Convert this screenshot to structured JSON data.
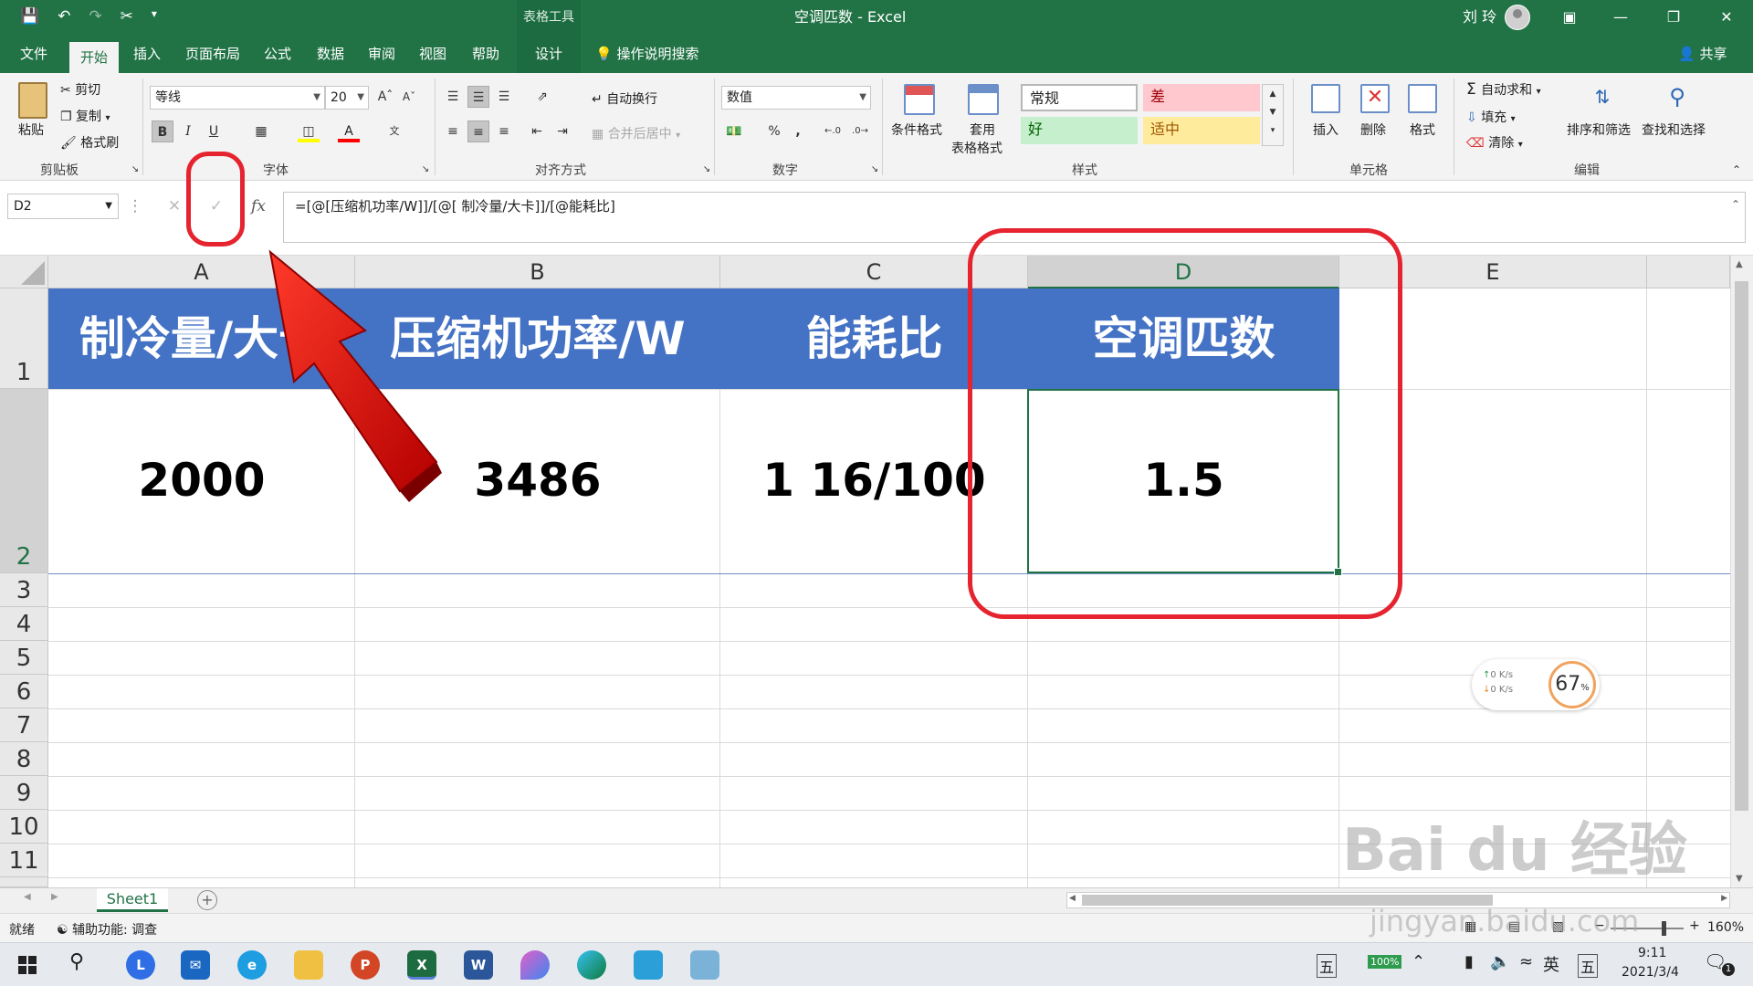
{
  "titlebar": {
    "context_label": "表格工具",
    "doc_title": "空调匹数 - Excel",
    "user": "刘 玲"
  },
  "tabs": [
    "文件",
    "开始",
    "插入",
    "页面布局",
    "公式",
    "数据",
    "审阅",
    "视图",
    "帮助",
    "设计"
  ],
  "active_tab": "开始",
  "tell_me": "操作说明搜索",
  "share": "共享",
  "ribbon": {
    "clipboard": {
      "paste": "粘贴",
      "cut": "剪切",
      "copy": "复制",
      "format_painter": "格式刷",
      "label": "剪贴板"
    },
    "font": {
      "name": "等线",
      "size": "20",
      "label": "字体",
      "bold": "B",
      "italic": "I",
      "underline": "U"
    },
    "alignment": {
      "wrap": "自动换行",
      "merge": "合并后居中",
      "label": "对齐方式"
    },
    "number": {
      "format": "数值",
      "percent": "%",
      "comma": ",",
      "label": "数字"
    },
    "styles": {
      "conditional": "条件格式",
      "table_fmt": [
        "套用",
        "表格格式"
      ],
      "normal": "常规",
      "bad": "差",
      "good": "好",
      "neutral": "适中",
      "label": "样式"
    },
    "cells": {
      "insert": "插入",
      "delete": "删除",
      "format": "格式",
      "label": "单元格"
    },
    "editing": {
      "autosum": "自动求和",
      "fill": "填充",
      "clear": "清除",
      "sort": "排序和筛选",
      "find": "查找和选择",
      "label": "编辑"
    }
  },
  "formula_bar": {
    "name_box": "D2",
    "fx": "fx",
    "formula": "=[@[压缩机功率/W]]/[@[ 制冷量/大卡]]/[@能耗比]"
  },
  "columns": [
    "A",
    "B",
    "C",
    "D",
    "E"
  ],
  "selected_column": "D",
  "rows": [
    "1",
    "2",
    "3",
    "4",
    "5",
    "6",
    "7",
    "8",
    "9",
    "10",
    "11"
  ],
  "table": {
    "headers": [
      "制冷量/大卡",
      "压缩机功率/W",
      "能耗比",
      "空调匹数"
    ],
    "values": [
      "2000",
      "3486",
      "1 16/100",
      "1.5"
    ]
  },
  "sheet_tab": "Sheet1",
  "status": {
    "ready": "就绪",
    "accessibility": "辅助功能: 调查",
    "zoom": "160%"
  },
  "net_widget": {
    "up": "0 K/s",
    "down": "0 K/s",
    "cpu": "67",
    "unit": "%"
  },
  "taskbar": {
    "ime": "五",
    "battery": "100%",
    "lang": "英",
    "ime2": "五",
    "time": "9:11",
    "date": "2021/3/4",
    "notify": "1"
  },
  "watermark": "Bai du 经验",
  "watermark_url": "jingyan.baidu.com",
  "colors": {
    "excel_green": "#217346",
    "header_blue": "#4472c4",
    "annotation_red": "#e5242f"
  }
}
